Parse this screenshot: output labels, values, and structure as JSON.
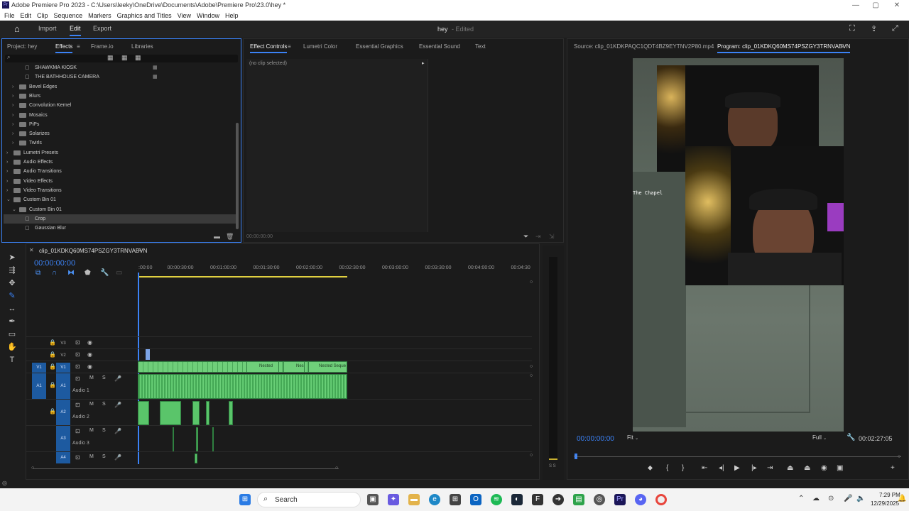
{
  "window": {
    "title": "Adobe Premiere Pro 2023 - C:\\Users\\leeky\\OneDrive\\Documents\\Adobe\\Premiere Pro\\23.0\\hey *",
    "app_badge": "Pr"
  },
  "menu": [
    "File",
    "Edit",
    "Clip",
    "Sequence",
    "Markers",
    "Graphics and Titles",
    "View",
    "Window",
    "Help"
  ],
  "header": {
    "tabs": [
      "Import",
      "Edit",
      "Export"
    ],
    "active_tab": "Edit",
    "project": "hey",
    "status": "- Edited"
  },
  "left_panel": {
    "tabs": [
      "Project: hey",
      "Effects",
      "Frame.io",
      "Libraries"
    ],
    "active_tab": "Effects",
    "items": [
      {
        "label": "SHAWKMA KIOSK",
        "indent": 2,
        "kind": "preset"
      },
      {
        "label": "THE BATHHOUSE CAMERA",
        "indent": 2,
        "kind": "preset"
      },
      {
        "label": "Bevel Edges",
        "indent": 1,
        "kind": "folder"
      },
      {
        "label": "Blurs",
        "indent": 1,
        "kind": "folder"
      },
      {
        "label": "Convolution Kernel",
        "indent": 1,
        "kind": "folder"
      },
      {
        "label": "Mosaics",
        "indent": 1,
        "kind": "folder"
      },
      {
        "label": "PiPs",
        "indent": 1,
        "kind": "folder"
      },
      {
        "label": "Solarizes",
        "indent": 1,
        "kind": "folder"
      },
      {
        "label": "Twirls",
        "indent": 1,
        "kind": "folder"
      },
      {
        "label": "Lumetri Presets",
        "indent": 0,
        "kind": "folder"
      },
      {
        "label": "Audio Effects",
        "indent": 0,
        "kind": "folder"
      },
      {
        "label": "Audio Transitions",
        "indent": 0,
        "kind": "folder"
      },
      {
        "label": "Video Effects",
        "indent": 0,
        "kind": "folder"
      },
      {
        "label": "Video Transitions",
        "indent": 0,
        "kind": "folder"
      },
      {
        "label": "Custom Bin 01",
        "indent": 0,
        "kind": "folder-open"
      },
      {
        "label": "Custom Bin 01",
        "indent": 1,
        "kind": "folder-open"
      },
      {
        "label": "Crop",
        "indent": 2,
        "kind": "effect",
        "selected": true
      },
      {
        "label": "Gaussian Blur",
        "indent": 2,
        "kind": "effect"
      }
    ]
  },
  "effect_controls": {
    "tabs": [
      "Effect Controls",
      "Lumetri Color",
      "Essential Graphics",
      "Essential Sound",
      "Text"
    ],
    "active_tab": "Effect Controls",
    "empty_label": "(no clip selected)",
    "timecode": "00:00:00:00"
  },
  "monitors": {
    "source_tab": "Source: clip_01KDKPAQC1QDT4BZ9EYTNV2P80.mp4",
    "program_tab": "Program: clip_01KDKQ60MS74PSZGY3TRNVABVN",
    "timecode": "00:00:00:00",
    "fit": "Fit",
    "quality": "Full",
    "duration": "00:02:27:05",
    "overlay_text": "The Chapel"
  },
  "timeline": {
    "sequence_name": "clip_01KDKQ60MS74PSZGY3TRNVABVN",
    "timecode": "00:00:00:00",
    "ruler": [
      ":00:00",
      "00:00:30:00",
      "00:01:00:00",
      "00:01:30:00",
      "00:02:00:00",
      "00:02:30:00",
      "00:03:00:00",
      "00:03:30:00",
      "00:04:00:00",
      "00:04:30"
    ],
    "tracks": {
      "V3": "V3",
      "V2": "V2",
      "V1": "V1",
      "A1": "A1",
      "A2": "A2",
      "A3": "A3",
      "A4": "A4",
      "audio1": "Audio 1",
      "audio2": "Audio 2",
      "audio3": "Audio 3"
    },
    "clips": [
      "Nested",
      "Nes",
      "Nested Seque"
    ],
    "meter_label": "S S"
  },
  "taskbar": {
    "search": "Search",
    "time": "7:29 PM",
    "date": "12/29/2025"
  },
  "colors": {
    "accent": "#3b82f6",
    "clip": "#5ac56a",
    "track_on": "#1d5aa0"
  }
}
